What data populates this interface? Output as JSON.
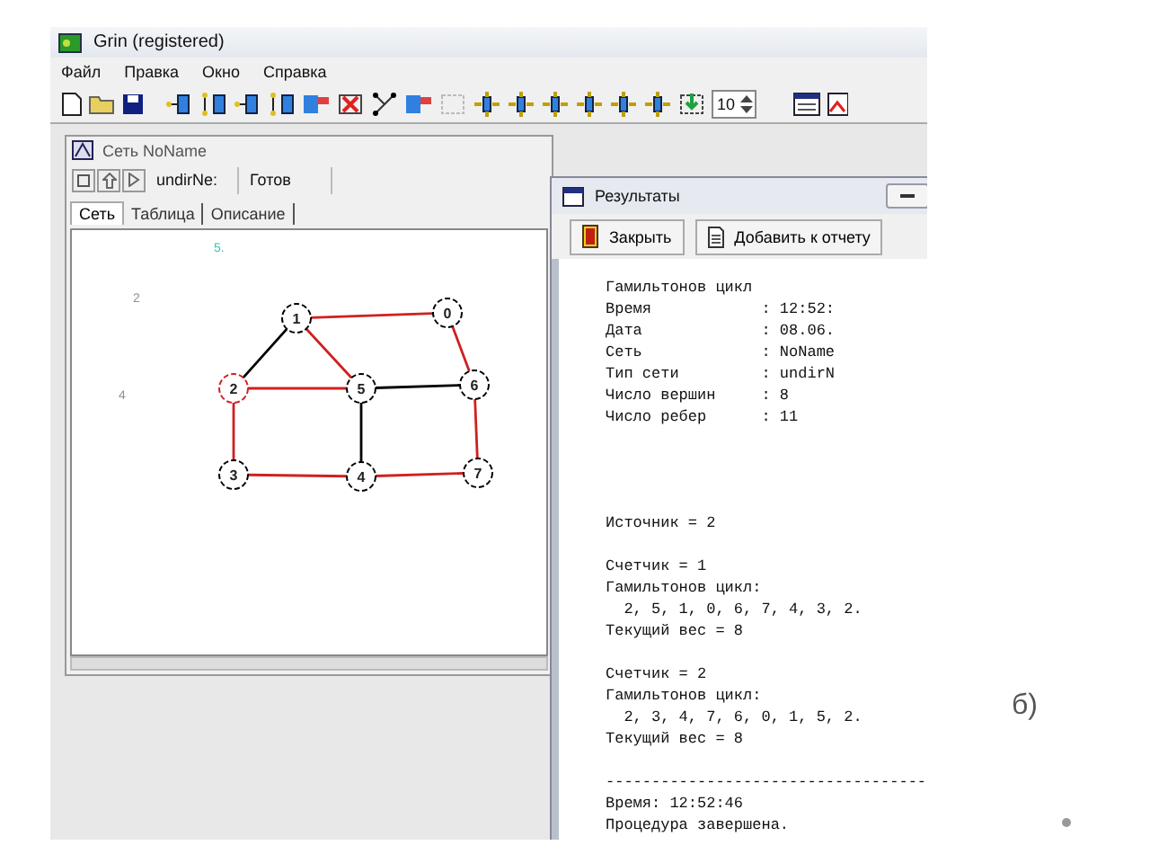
{
  "window": {
    "title": "Grin (registered)"
  },
  "menu": [
    "Файл",
    "Правка",
    "Окно",
    "Справка"
  ],
  "toolbar": {
    "spin_value": "10"
  },
  "graph_window": {
    "title": "Сеть NoName",
    "status": [
      "undirNe:",
      "Готов"
    ],
    "tabs": [
      {
        "label": "Сеть",
        "selected": true
      },
      {
        "label": "Таблица",
        "selected": false
      },
      {
        "label": "Описание",
        "selected": false
      }
    ],
    "canvas_marks": [
      {
        "text": "5.",
        "color": "#40c0b0"
      },
      {
        "text": "2",
        "color": "#909090"
      },
      {
        "text": "4",
        "color": "#909090"
      }
    ],
    "nodes": [
      {
        "label": "0",
        "color": "#000000"
      },
      {
        "label": "1",
        "color": "#000000"
      },
      {
        "label": "2",
        "color": "#d02020"
      },
      {
        "label": "3",
        "color": "#000000"
      },
      {
        "label": "4",
        "color": "#000000"
      },
      {
        "label": "5",
        "color": "#000000"
      },
      {
        "label": "6",
        "color": "#000000"
      },
      {
        "label": "7",
        "color": "#000000"
      }
    ],
    "edges": [
      {
        "color": "#d02020"
      },
      {
        "color": "#000000"
      },
      {
        "color": "#d02020"
      },
      {
        "color": "#d02020"
      },
      {
        "color": "#000000"
      },
      {
        "color": "#d02020"
      },
      {
        "color": "#d02020"
      },
      {
        "color": "#d02020"
      },
      {
        "color": "#000000"
      },
      {
        "color": "#d02020"
      },
      {
        "color": "#d02020"
      }
    ]
  },
  "results_window": {
    "title": "Результаты",
    "buttons": [
      "Закрыть",
      "Добавить к отчету"
    ],
    "header": [
      "Гамильтонов цикл",
      "Время            : 12:52:",
      "Дата             : 08.06.",
      "Сеть             : NoName",
      "Тип сети         : undirN",
      "Число вершин     : 8",
      "Число ребер      : 11"
    ],
    "source": "Источник = 2",
    "counters": [
      {
        "lines": [
          "Счетчик = 1",
          "Гамильтонов цикл:",
          "  2, 5, 1, 0, 6, 7, 4, 3, 2.",
          "Текущий вес = 8"
        ]
      },
      {
        "lines": [
          "Счетчик = 2",
          "Гамильтонов цикл:",
          "  2, 3, 4, 7, 6, 0, 1, 5, 2.",
          "Текущий вес = 8"
        ]
      }
    ],
    "footer": [
      "-----------------------------------",
      "Время: 12:52:46",
      "Процедура завершена."
    ]
  },
  "slide_caption": "б)"
}
